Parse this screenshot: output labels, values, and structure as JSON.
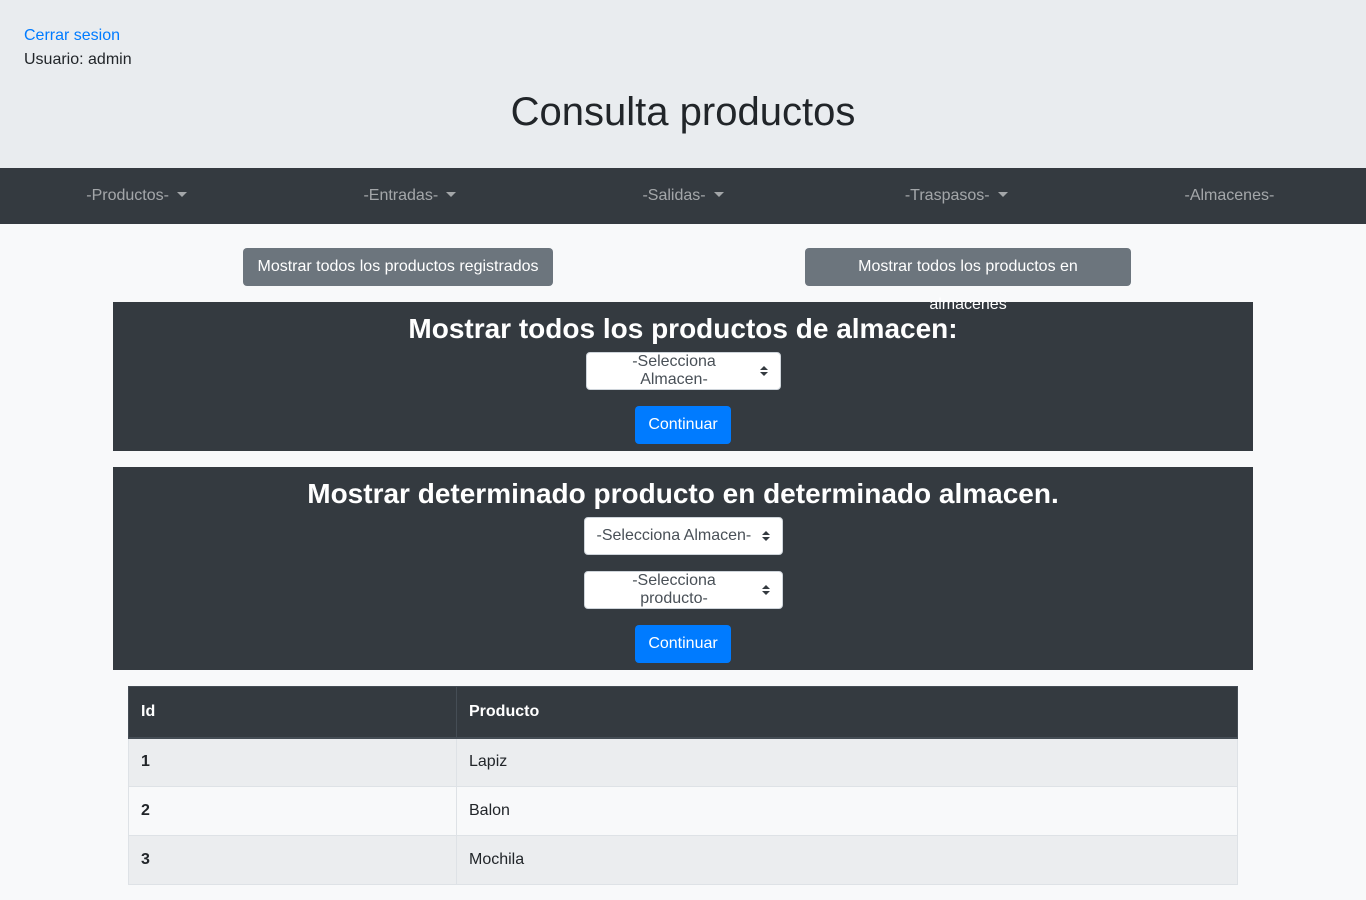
{
  "header": {
    "logout_label": "Cerrar sesion",
    "user_label": "Usuario: admin",
    "title": "Consulta productos"
  },
  "nav": {
    "items": [
      {
        "label": "-Productos-",
        "dropdown": true
      },
      {
        "label": "-Entradas-",
        "dropdown": true
      },
      {
        "label": "-Salidas-",
        "dropdown": true
      },
      {
        "label": "-Traspasos-",
        "dropdown": true
      },
      {
        "label": "-Almacenes-",
        "dropdown": false
      }
    ]
  },
  "actions": {
    "show_all_registered": "Mostrar todos los productos registrados",
    "show_all_in_warehouses": "Mostrar todos los productos en almacenes"
  },
  "panel1": {
    "title": "Mostrar todos los productos de almacen:",
    "warehouse_select": "-Selecciona Almacen-",
    "continue_label": "Continuar"
  },
  "panel2": {
    "title": "Mostrar determinado producto en determinado almacen.",
    "warehouse_select": "-Selecciona Almacen-",
    "product_select": "-Selecciona producto-",
    "continue_label": "Continuar"
  },
  "table": {
    "columns": [
      "Id",
      "Producto"
    ],
    "rows": [
      [
        "1",
        "Lapiz"
      ],
      [
        "2",
        "Balon"
      ],
      [
        "3",
        "Mochila"
      ]
    ]
  },
  "colors": {
    "primary": "#007bff",
    "secondary": "#6c757d",
    "dark": "#343a40"
  }
}
